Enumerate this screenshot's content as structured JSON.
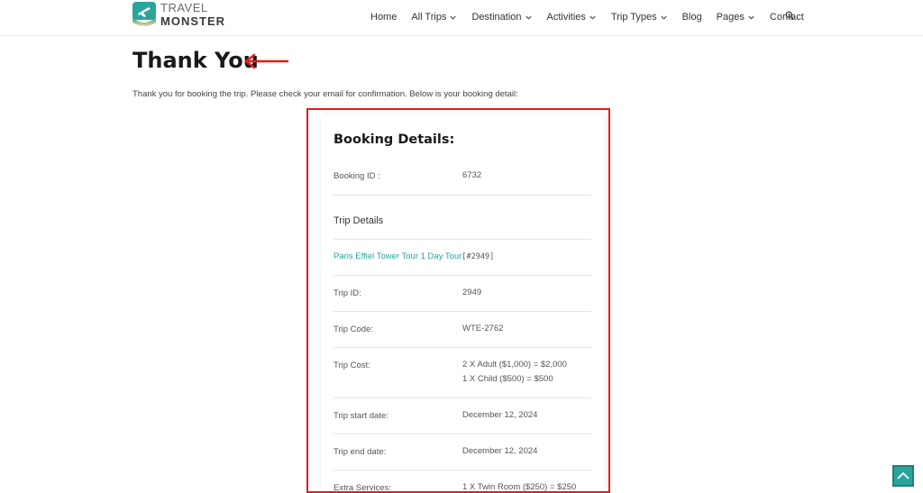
{
  "brand": {
    "line1": "TRAVEL",
    "line2": "MONSTER",
    "color": "#2aa59b"
  },
  "nav": {
    "items": [
      {
        "label": "Home",
        "dropdown": false
      },
      {
        "label": "All Trips",
        "dropdown": true
      },
      {
        "label": "Destination",
        "dropdown": true
      },
      {
        "label": "Activities",
        "dropdown": true
      },
      {
        "label": "Trip Types",
        "dropdown": true
      },
      {
        "label": "Blog",
        "dropdown": false
      },
      {
        "label": "Pages",
        "dropdown": true
      },
      {
        "label": "Contact",
        "dropdown": false
      }
    ],
    "search_icon": "search-icon"
  },
  "page": {
    "title": "Thank You",
    "intro": "Thank you for booking the trip. Please check your email for confirmation. Below is your booking detail:",
    "highlight_color": "#e11c1c"
  },
  "booking": {
    "title": "Booking Details:",
    "booking_id_label": "Booking ID :",
    "booking_id": "6732",
    "trip_details_label": "Trip Details",
    "trip_name": "Paris Effiel Tower Tour 1 Day Tour",
    "trip_tag": "[#2949]",
    "trip_id_label": "Trip ID:",
    "trip_id": "2949",
    "trip_code_label": "Trip Code:",
    "trip_code": "WTE-2762",
    "trip_cost_label": "Trip Cost:",
    "trip_cost_line1": "2 X Adult ($1,000) = $2,000",
    "trip_cost_line2": "1 X Child ($500) = $500",
    "start_label": "Trip start date:",
    "start_date": "December 12, 2024",
    "end_label": "Trip end date:",
    "end_date": "December 12, 2024",
    "extras_label": "Extra Services:",
    "extras_value": "1 X Twin Room ($250) = $250"
  },
  "scroll_top_icon": "arrow-up-icon"
}
